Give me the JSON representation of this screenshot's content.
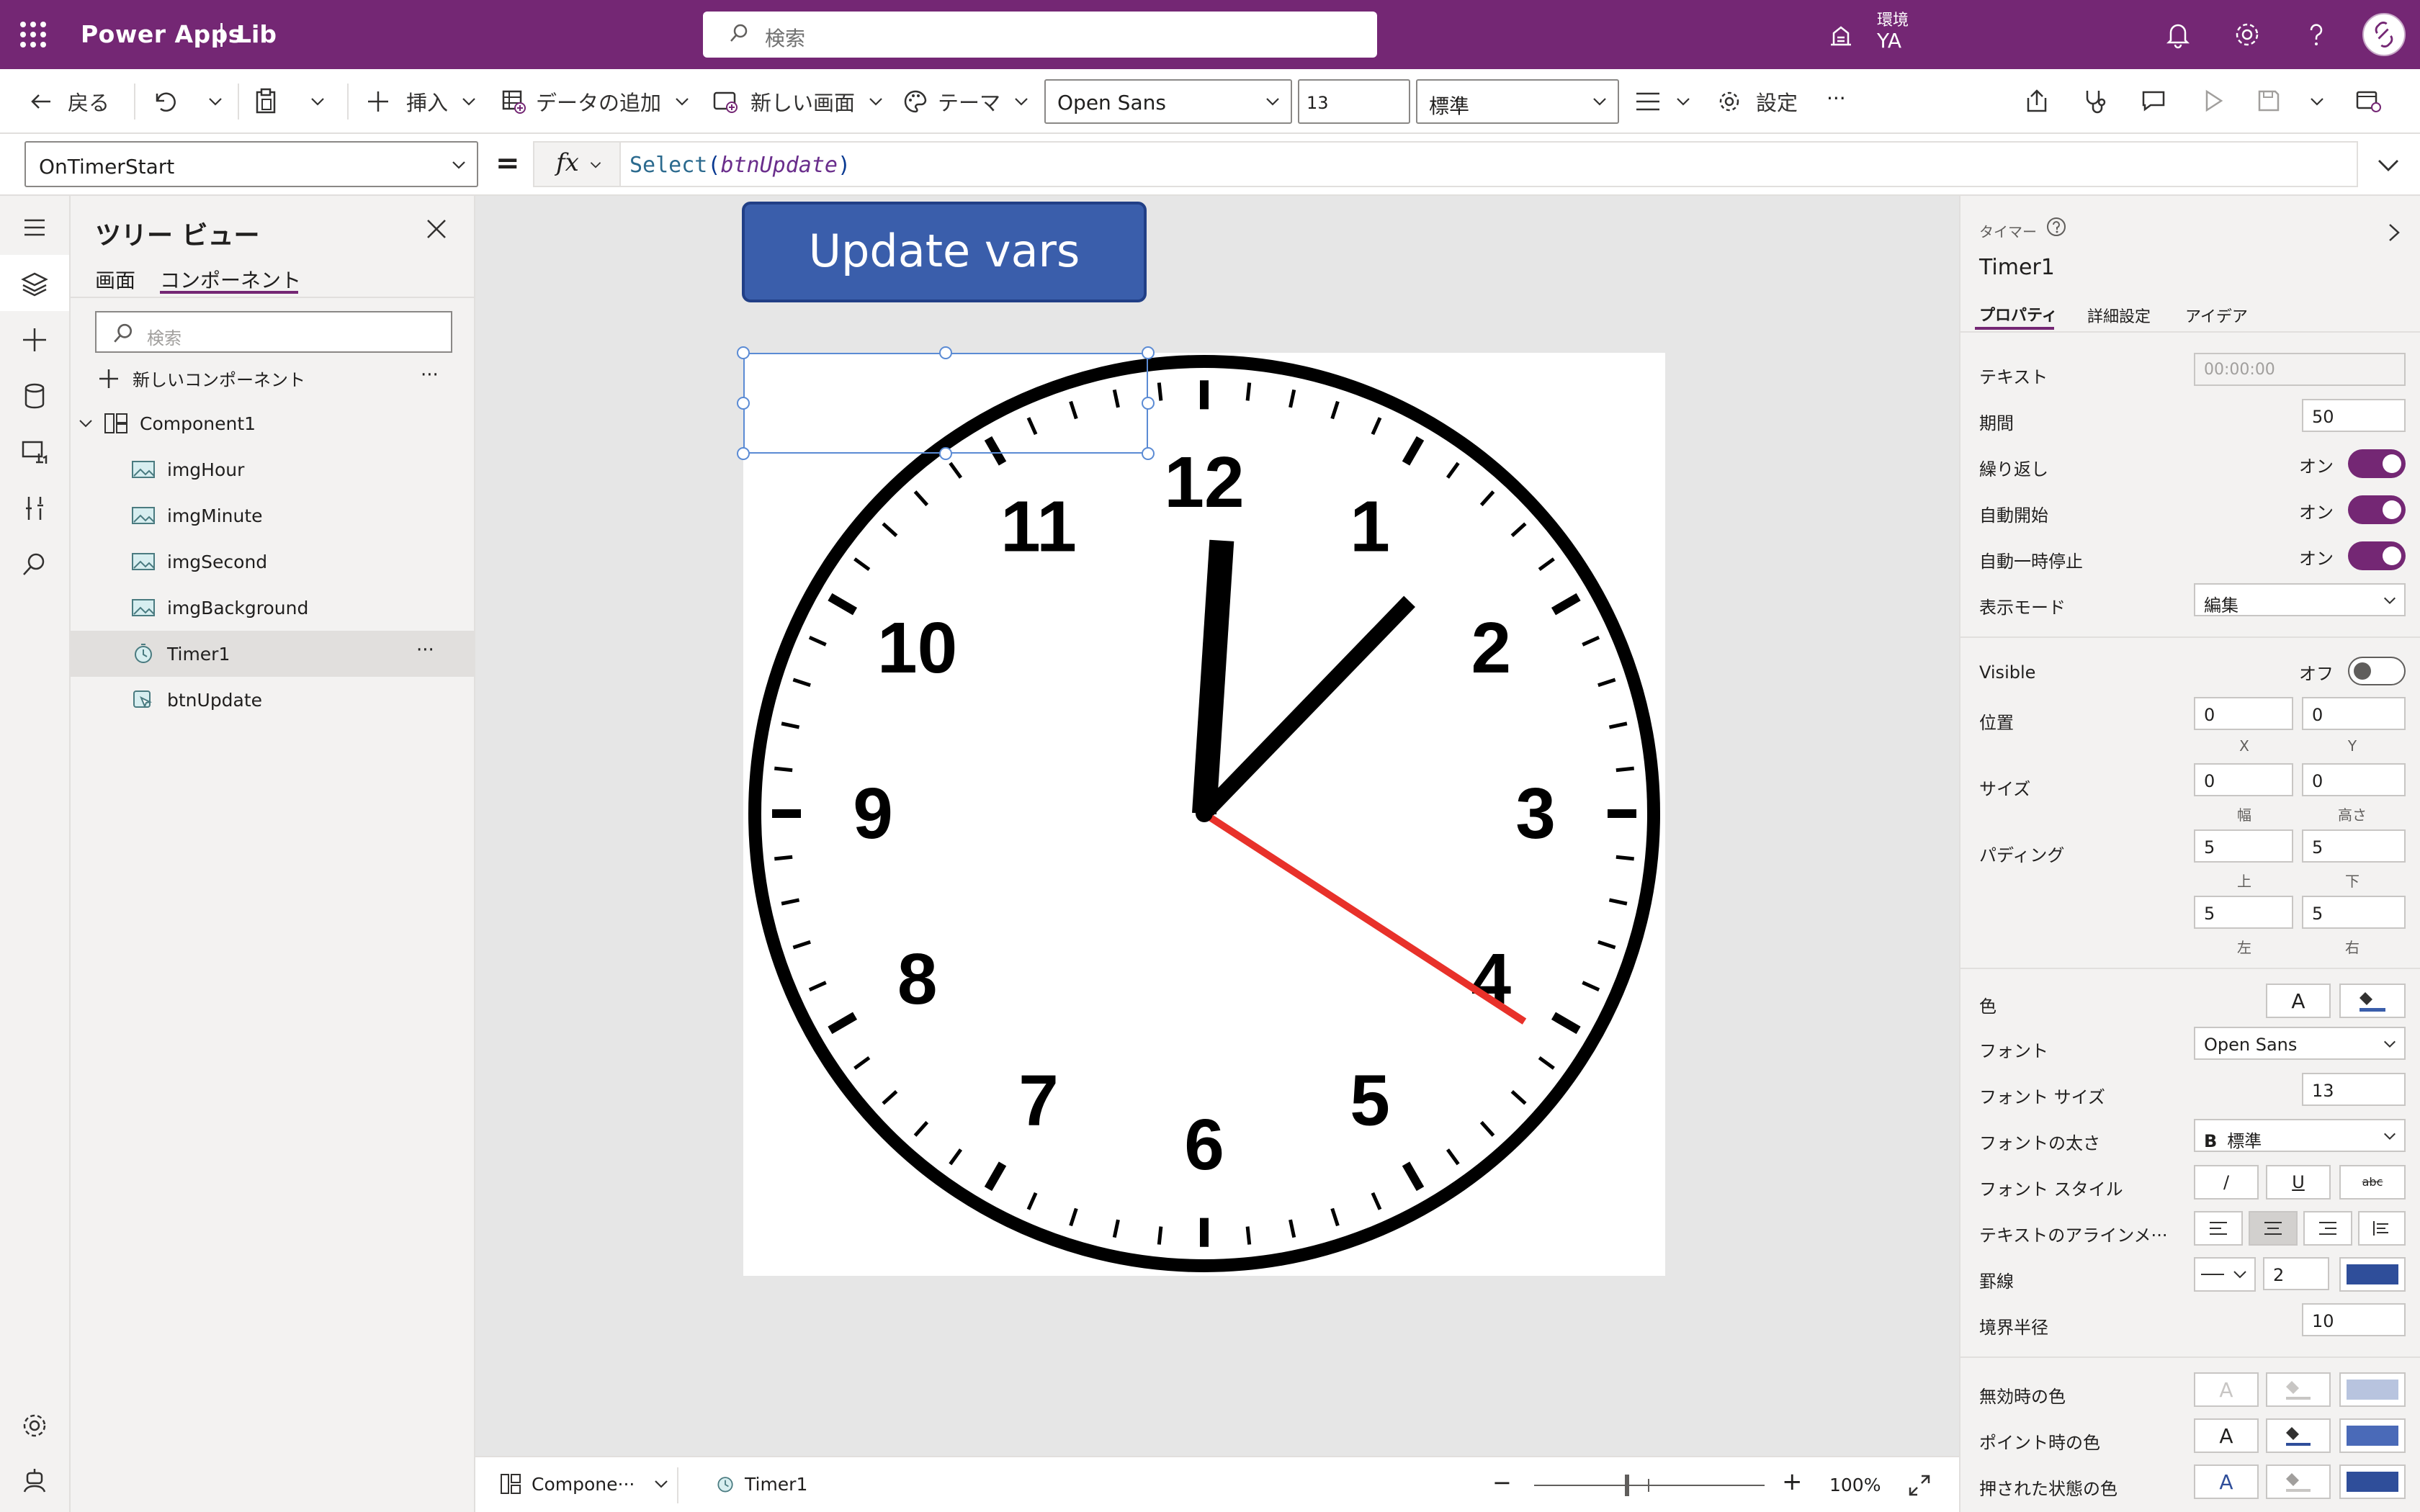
{
  "topbar": {
    "app_title": "Power Apps",
    "separator": "|",
    "app_name": "Lib",
    "search_placeholder": "検索",
    "env_label": "環境",
    "env_user": "YA"
  },
  "toolbar": {
    "back": "戻る",
    "insert": "挿入",
    "add_data": "データの追加",
    "new_screen": "新しい画面",
    "theme": "テーマ",
    "font": "Open Sans",
    "font_size": "13",
    "font_weight": "標準",
    "settings": "設定",
    "more": "···"
  },
  "formula_bar": {
    "property": "OnTimerStart",
    "equals": "=",
    "fx": "fx",
    "func": "Select",
    "open": "(",
    "arg": "btnUpdate",
    "close": ")"
  },
  "tree": {
    "title": "ツリー ビュー",
    "tab_screens": "画面",
    "tab_components": "コンポーネント",
    "search_placeholder": "検索",
    "new_component": "新しいコンポーネント",
    "more": "···",
    "root": "Component1",
    "items": [
      {
        "label": "imgHour",
        "icon": "image-icon"
      },
      {
        "label": "imgMinute",
        "icon": "image-icon"
      },
      {
        "label": "imgSecond",
        "icon": "image-icon"
      },
      {
        "label": "imgBackground",
        "icon": "image-icon"
      },
      {
        "label": "Timer1",
        "icon": "timer-icon",
        "selected": true
      },
      {
        "label": "btnUpdate",
        "icon": "button-icon"
      }
    ]
  },
  "canvas": {
    "button_text": "Update vars",
    "clock_numbers": [
      "12",
      "1",
      "2",
      "3",
      "4",
      "5",
      "6",
      "7",
      "8",
      "9",
      "10",
      "11"
    ],
    "clock_time": {
      "hour": 12,
      "minute": 7,
      "second": 20.5
    }
  },
  "status": {
    "screen": "Compone···",
    "control": "Timer1",
    "minus": "−",
    "plus": "+",
    "zoom": "100%"
  },
  "props": {
    "control_type": "タイマー",
    "control_name": "Timer1",
    "tab_properties": "プロパティ",
    "tab_advanced": "詳細設定",
    "tab_ideas": "アイデア",
    "text_label": "テキスト",
    "text_value": "00:00:00",
    "duration_label": "期間",
    "duration_value": "50",
    "repeat_label": "繰り返し",
    "autostart_label": "自動開始",
    "autopause_label": "自動一時停止",
    "on": "オン",
    "off": "オフ",
    "displaymode_label": "表示モード",
    "displaymode_value": "編集",
    "visible_label": "Visible",
    "position_label": "位置",
    "pos_x": "0",
    "pos_y": "0",
    "x": "X",
    "y": "Y",
    "size_label": "サイズ",
    "width": "0",
    "height": "0",
    "width_label": "幅",
    "height_label": "高さ",
    "padding_label": "パディング",
    "pad_top": "5",
    "pad_bottom": "5",
    "pad_left": "5",
    "pad_right": "5",
    "top": "上",
    "bottom": "下",
    "left": "左",
    "right": "右",
    "color_label": "色",
    "font_label": "フォント",
    "font_value": "Open Sans",
    "fontsize_label": "フォント サイズ",
    "fontsize_value": "13",
    "fontweight_label": "フォントの太さ",
    "fontweight_value": "標準",
    "fontweight_glyph": "B",
    "fontstyle_label": "フォント スタイル",
    "italic": "/",
    "underline": "U",
    "strike": "abc",
    "align_label": "テキストのアラインメ···",
    "border_label": "罫線",
    "border_width": "2",
    "radius_label": "境界半径",
    "radius_value": "10",
    "disabled_color_label": "無効時の色",
    "hover_color_label": "ポイント時の色",
    "pressed_color_label": "押された状態の色",
    "color_glyph": "A"
  },
  "colors": {
    "brand": "#742774",
    "button_fill": "#3a5eab",
    "border_color": "#2f4e9a",
    "second_hand": "#e8312a"
  }
}
